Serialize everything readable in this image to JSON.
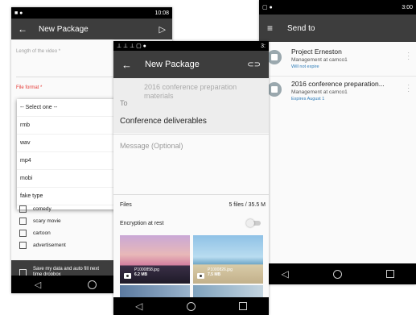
{
  "phone1": {
    "status_time": "10:08",
    "title": "New Package",
    "length_label": "Length of the video *",
    "format_label": "File format *",
    "dropdown_options": [
      "-- Select one --",
      "rmb",
      "wav",
      "mp4",
      "mobi",
      "fake type"
    ],
    "checkboxes": [
      "comedy",
      "scary movie",
      "cartoon",
      "advertisement"
    ],
    "save_text": "Save my data and auto fill next time dropbox",
    "colors": {
      "appbar": "#3d3d3d",
      "error": "#e53935"
    }
  },
  "phone2": {
    "status_time": "3:",
    "title": "New Package",
    "to_label": "To",
    "to_value": "2016 conference preparation materials",
    "subject": "Conference deliverables",
    "message_placeholder": "Message (Optional)",
    "files_label": "Files",
    "files_summary": "5 files / 35.5 M",
    "encryption_label": "Encryption at rest",
    "thumbs": [
      {
        "name": "P1000858.jpg",
        "size": "6.2 MB"
      },
      {
        "name": "P1000826.jpg",
        "size": "7.5 MB"
      }
    ]
  },
  "phone3": {
    "status_time": "3:00",
    "title": "Send to",
    "items": [
      {
        "title": "Project Erneston",
        "subtitle": "Management at camco1",
        "expiry": "Will not expire"
      },
      {
        "title": "2016 conference preparation...",
        "subtitle": "Management at camco1",
        "expiry": "Expires August 1"
      }
    ]
  }
}
